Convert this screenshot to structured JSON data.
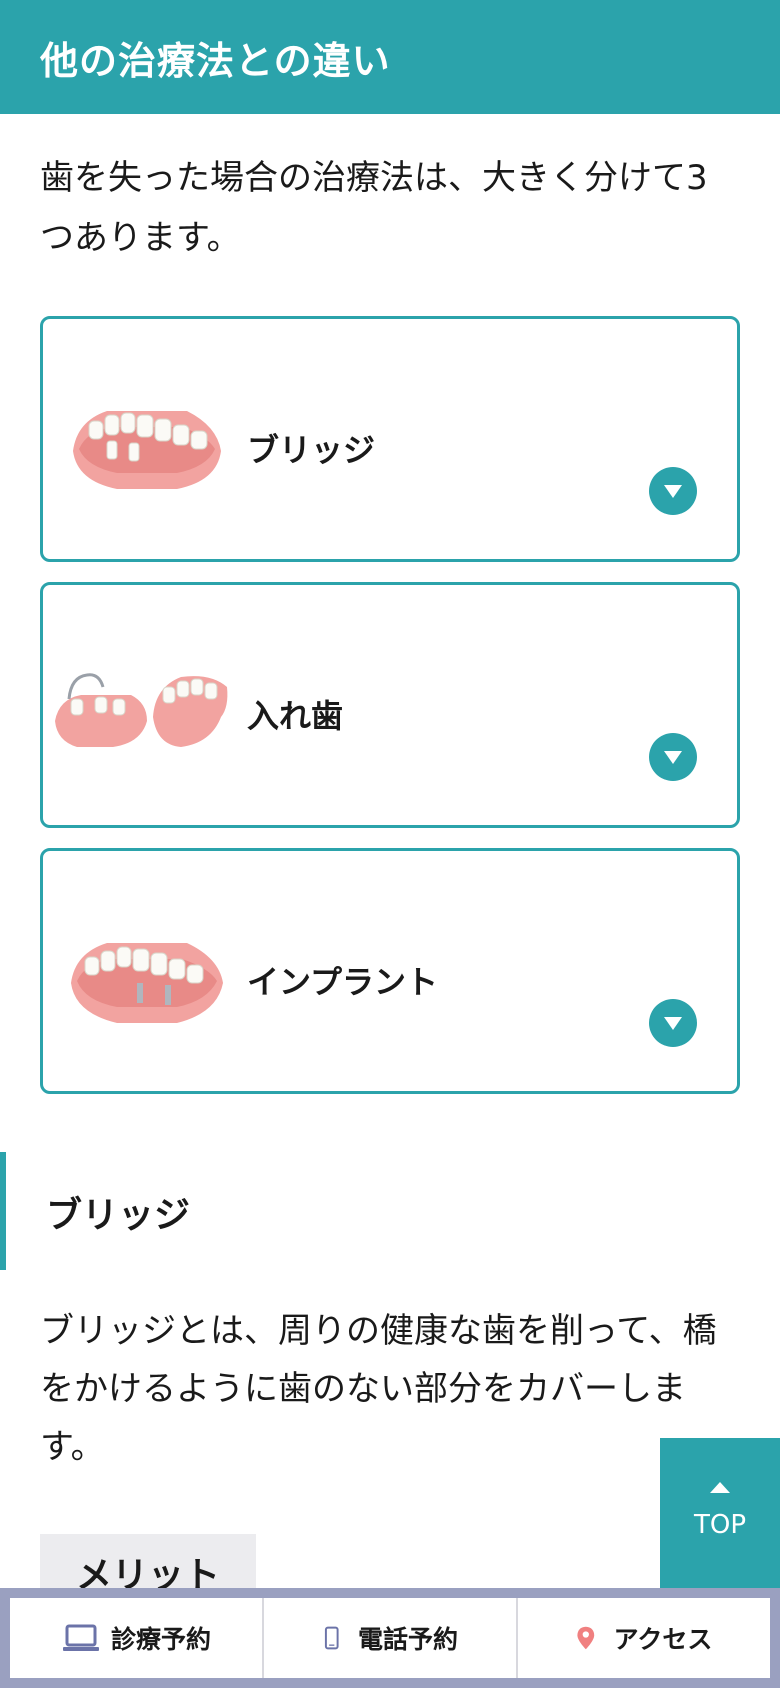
{
  "header": {
    "title": "他の治療法との違い"
  },
  "intro": {
    "text": "歯を失った場合の治療法は、大きく分けて3つあります。"
  },
  "cards": [
    {
      "label": "ブリッジ",
      "icon": "bridge-teeth-image"
    },
    {
      "label": "入れ歯",
      "icon": "denture-teeth-image"
    },
    {
      "label": "インプラント",
      "icon": "implant-teeth-image"
    }
  ],
  "section": {
    "title": "ブリッジ",
    "body": "ブリッジとは、周りの健康な歯を削って、橋をかけるように歯のない部分をカバーします。",
    "merit_label": "メリット"
  },
  "top_button": {
    "label": "TOP"
  },
  "bottom_nav": [
    {
      "label": "診療予約",
      "icon": "laptop-icon"
    },
    {
      "label": "電話予約",
      "icon": "smartphone-icon"
    },
    {
      "label": "アクセス",
      "icon": "map-pin-icon"
    }
  ],
  "colors": {
    "accent": "#2ba3ab",
    "nav_frame": "#9aa0c0",
    "pin": "#f08080"
  }
}
